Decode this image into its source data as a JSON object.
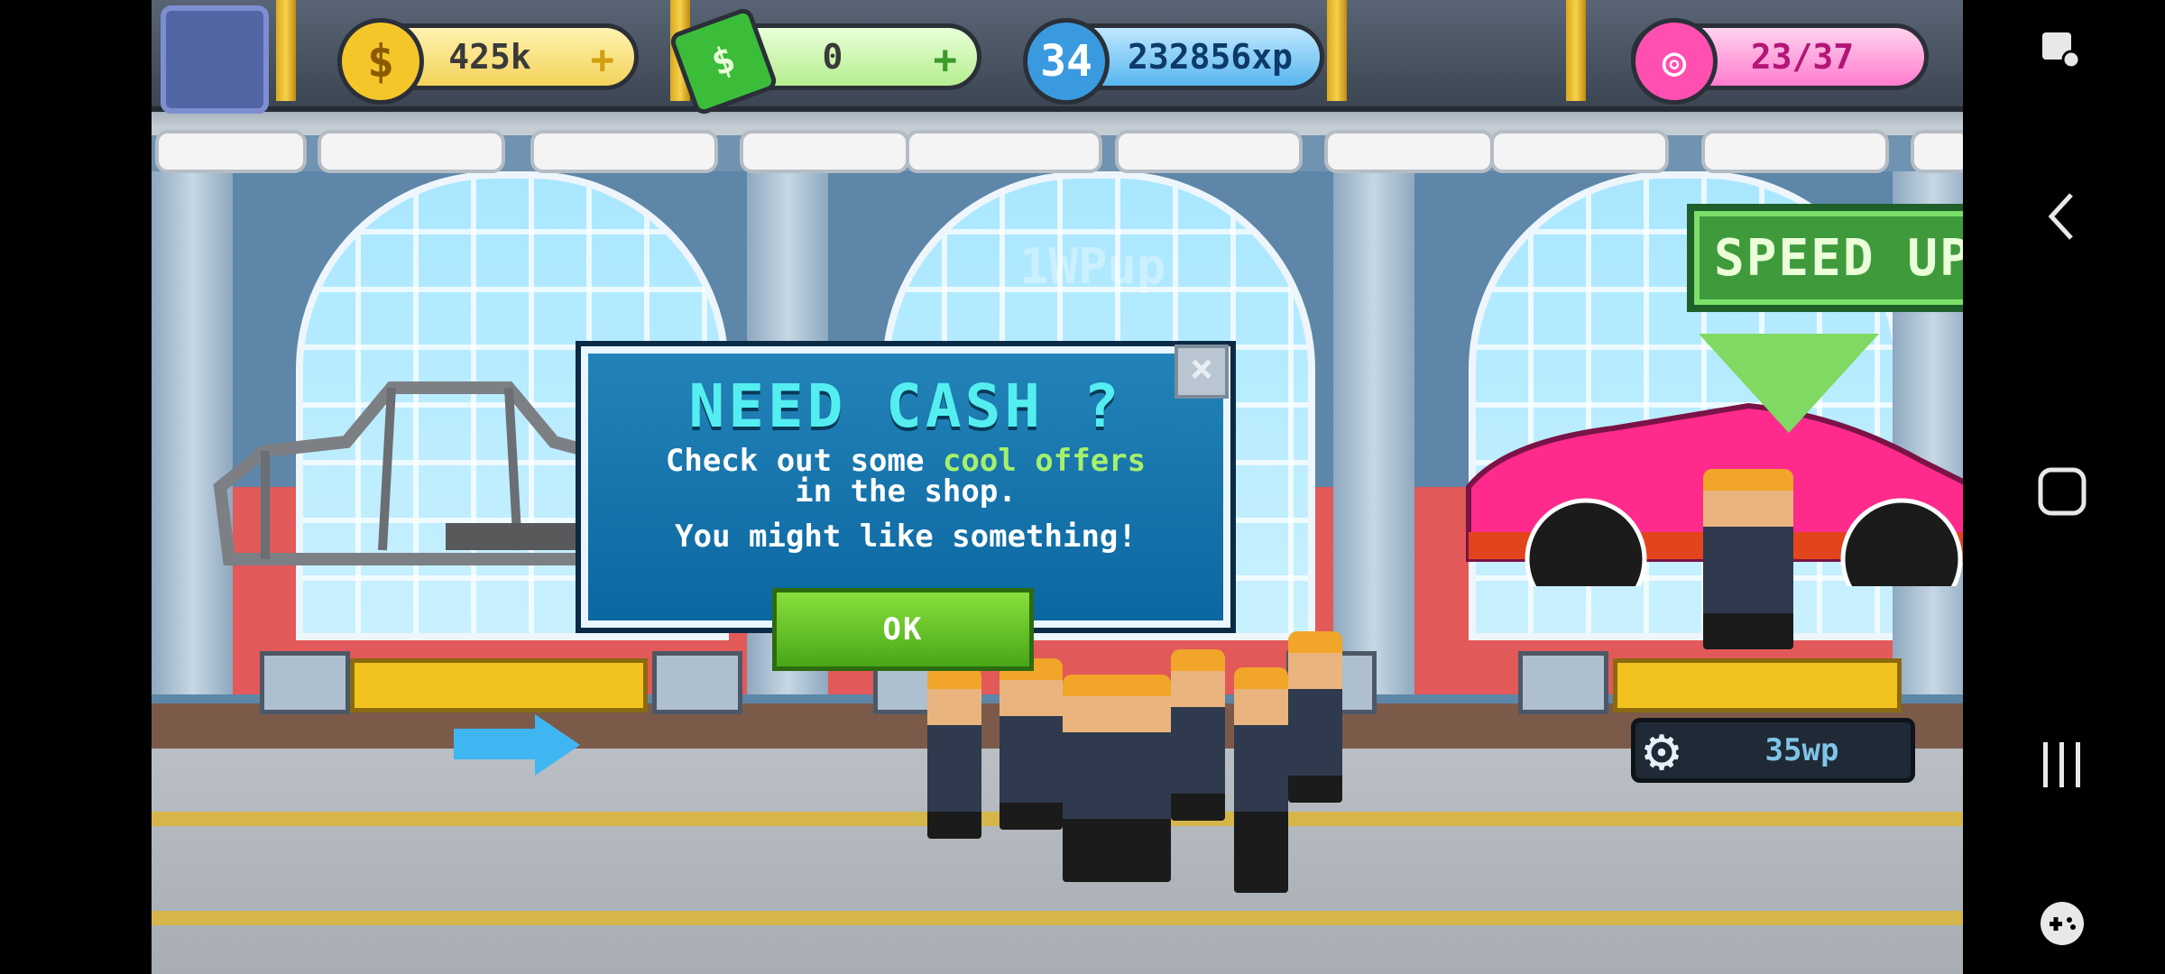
{
  "hud": {
    "coins": "425k",
    "cash": "0",
    "level": "34",
    "xp": "232856xp",
    "donuts": "23/37",
    "plus_symbol": "+"
  },
  "watermark": "1WPup",
  "speed_up_label": "SPEED UP",
  "gear_badge": "35wp",
  "dialog": {
    "title": "NEED CASH ?",
    "line1_pre": "Check out some ",
    "line1_highlight": "cool offers",
    "line2": "in the shop.",
    "line3": "You might like something!",
    "ok_label": "OK",
    "close_symbol": "×"
  },
  "colors": {
    "dialog_bg": "#0b67a0",
    "title": "#54eef0",
    "highlight": "#a6f06a",
    "ok_button": "#49a617"
  }
}
